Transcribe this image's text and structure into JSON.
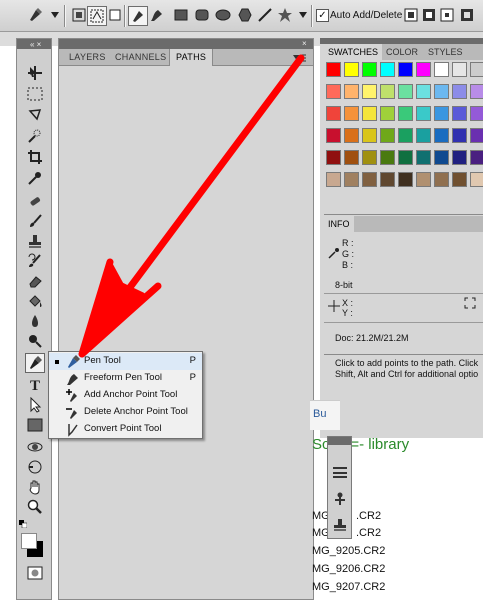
{
  "options_bar": {
    "auto_add_delete_label": "Auto Add/Delete",
    "auto_add_delete_checked": true
  },
  "paths_panel": {
    "tabs": [
      "LAYERS",
      "CHANNELS",
      "PATHS"
    ],
    "active_tab": "PATHS"
  },
  "swatches_panel": {
    "tabs": [
      "SWATCHES",
      "COLOR",
      "STYLES"
    ],
    "active_tab": "SWATCHES",
    "colors": [
      "#ff0000",
      "#ffff00",
      "#00ff00",
      "#00ffff",
      "#0000ff",
      "#ff00ff",
      "#ffffff",
      "#e6e6e6",
      "#cccccc",
      "#b3b3b3",
      "#ff6a5a",
      "#ffb36b",
      "#fff36b",
      "#bfe06b",
      "#6be0a0",
      "#6be0e0",
      "#6bb8f0",
      "#8c8ce8",
      "#b88ce8",
      "#f08cd0",
      "#f0443a",
      "#f5923a",
      "#f5e53a",
      "#9fd13a",
      "#3ac97a",
      "#3ac9c9",
      "#3a96e0",
      "#5a5ad8",
      "#945ad8",
      "#e05ab8",
      "#c8102e",
      "#d9701a",
      "#d9c51a",
      "#6fa81a",
      "#1aa060",
      "#1aa0a0",
      "#1a6cc0",
      "#3030b0",
      "#6a30b0",
      "#b03090",
      "#901010",
      "#a05010",
      "#a09010",
      "#4a7a10",
      "#107040",
      "#107070",
      "#104a90",
      "#202080",
      "#4a2080",
      "#802060",
      "#c8a890",
      "#a08060",
      "#806040",
      "#604830",
      "#403020",
      "#b09070",
      "#907050",
      "#705030",
      "#e0c8b0",
      "#d0b898"
    ]
  },
  "info_panel": {
    "tab": "INFO",
    "r_label": "R :",
    "g_label": "G :",
    "b_label": "B :",
    "bit_depth": "8-bit",
    "x_label": "X :",
    "y_label": "Y :",
    "doc": "Doc: 21.2M/21.2M",
    "hint_line1": "Click to add points to the path.  Click",
    "hint_line2": "Shift, Alt and Ctrl for additional optio"
  },
  "library": {
    "title_partial": "Scott =- library",
    "header_partial": "Bu",
    "files": [
      "MG",
      "MG",
      "MG_9205.CR2",
      "MG_9206.CR2",
      "MG_9207.CR2"
    ],
    "file_suffix_top": [
      ".CR2",
      ".CR2"
    ]
  },
  "flyout_menu": {
    "items": [
      {
        "label": "Pen Tool",
        "shortcut": "P",
        "selected": true,
        "icon": "pen-icon"
      },
      {
        "label": "Freeform Pen Tool",
        "shortcut": "P",
        "selected": false,
        "icon": "freeform-pen-icon"
      },
      {
        "label": "Add Anchor Point Tool",
        "shortcut": "",
        "selected": false,
        "icon": "add-anchor-icon"
      },
      {
        "label": "Delete Anchor Point Tool",
        "shortcut": "",
        "selected": false,
        "icon": "delete-anchor-icon"
      },
      {
        "label": "Convert Point Tool",
        "shortcut": "",
        "selected": false,
        "icon": "convert-point-icon"
      }
    ]
  },
  "annotation": {
    "arrow_color": "#ff0000"
  }
}
